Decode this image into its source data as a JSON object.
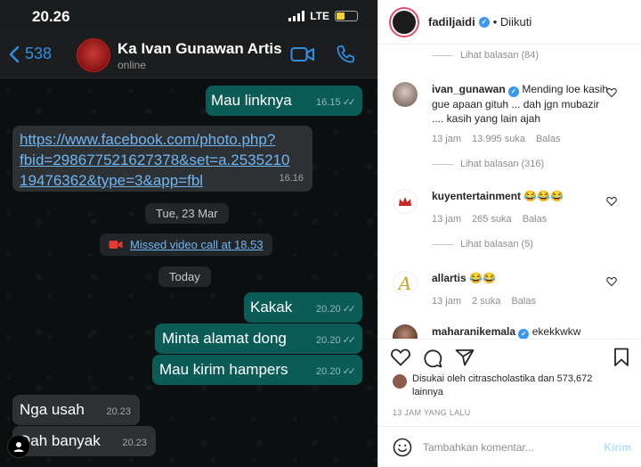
{
  "whatsapp": {
    "status_bar": {
      "time": "20.26",
      "network": "LTE"
    },
    "header": {
      "back_count": "538",
      "contact_name": "Ka Ivan Gunawan Artis",
      "contact_status": "online",
      "accent": "#2f8fe3"
    },
    "messages": [
      {
        "dir": "out",
        "text": "Mau linknya",
        "time": "16.15"
      },
      {
        "dir": "in",
        "lines": [
          "https://www.facebook.com/photo.php?",
          "fbid=298677521627378&set=a.2535210",
          "19476362&type=3&app=fbl"
        ],
        "time": "16.16"
      },
      {
        "dir": "out",
        "text": "Kakak",
        "time": "20.20"
      },
      {
        "dir": "out",
        "text": "Minta alamat dong",
        "time": "20.20"
      },
      {
        "dir": "out",
        "text": "Mau kirim hampers",
        "time": "20.20"
      },
      {
        "dir": "in",
        "text": "Nga usah",
        "time": "20.23"
      },
      {
        "dir": "in",
        "text": "Dah banyak",
        "time": "20.23"
      }
    ],
    "date_separators": [
      "Tue, 23 Mar",
      "Today"
    ],
    "missed_call": "Missed video call at 18.53",
    "colors": {
      "outgoing": "#0b5c56",
      "incoming": "#2d3134"
    }
  },
  "instagram": {
    "post_user": "fadiljaidi",
    "follow_status": "• Diikuti",
    "comments": [
      {
        "replies": "Lihat balasan (84)"
      },
      {
        "user": "ivan_gunawan",
        "text": "Mending loe kasih gue apaan gituh ... dah jgn mubazir .... kasih yang lain ajah",
        "time": "13 jam",
        "likes": "13.995 suka",
        "reply": "Balas",
        "replies": "Lihat balasan (316)"
      },
      {
        "user": "kuyentertainment",
        "text": "😂😂😂",
        "time": "13 jam",
        "likes": "265 suka",
        "reply": "Balas",
        "replies": "Lihat balasan (5)"
      },
      {
        "user": "allartis",
        "text": "😂😂",
        "time": "13 jam",
        "likes": "2 suka",
        "reply": "Balas"
      },
      {
        "user": "maharanikemala",
        "text": "ekekkwkw"
      }
    ],
    "liked_by": "Disukai oleh citrascholastika dan 573,672 lainnya",
    "time_ago": "13 JAM YANG LALU",
    "add_comment_placeholder": "Tambahkan komentar...",
    "post_button": "Kirim"
  }
}
